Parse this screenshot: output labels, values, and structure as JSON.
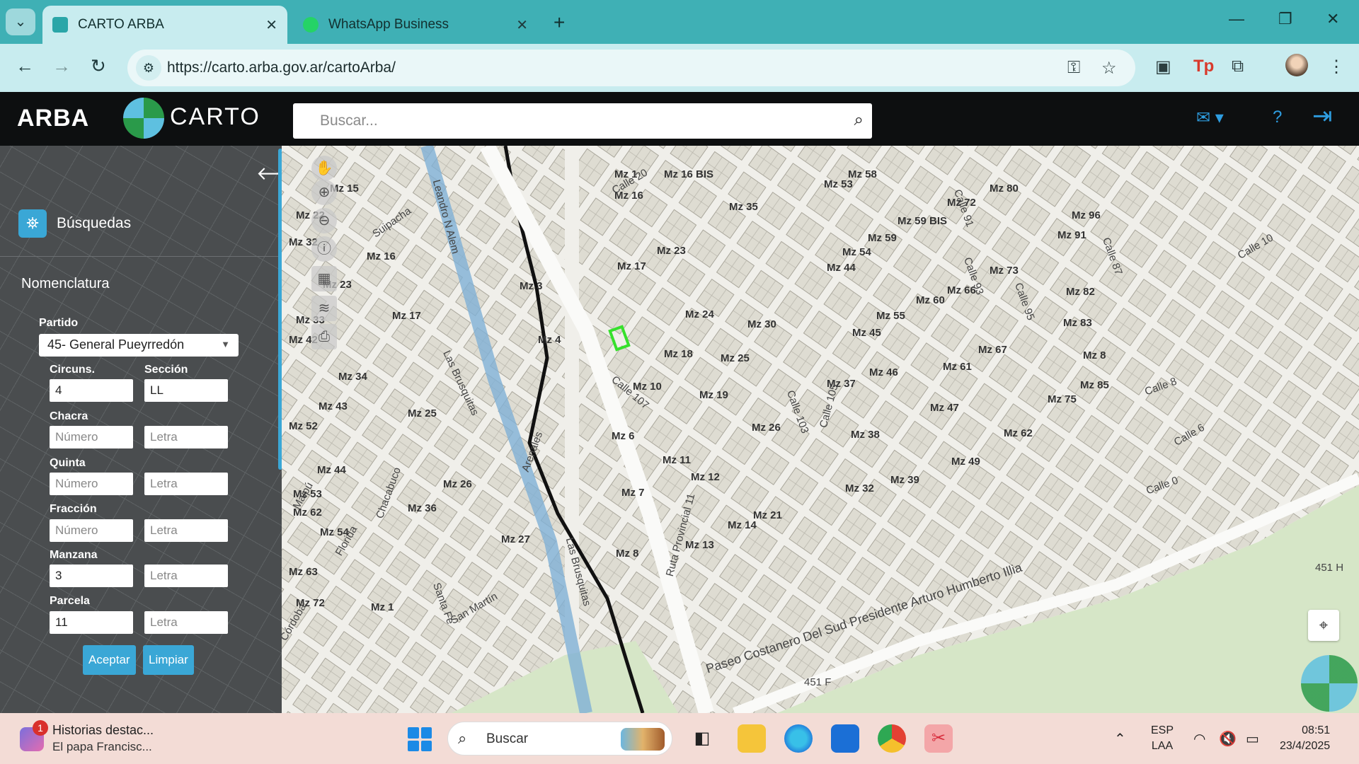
{
  "browser": {
    "tabs": [
      {
        "title": "CARTO ARBA",
        "active": true,
        "favicon": "arba-favicon"
      },
      {
        "title": "WhatsApp Business",
        "active": false,
        "favicon": "whatsapp-favicon"
      }
    ],
    "url": "https://carto.arba.gov.ar/cartoArba/"
  },
  "app": {
    "logo": "ARBA",
    "carto": "CARTO",
    "search_placeholder": "Buscar..."
  },
  "panel": {
    "busquedas": "Búsquedas",
    "section": "Nomenclatura",
    "partido_label": "Partido",
    "partido_value": "45- General Pueyrredón",
    "circuns_label": "Circuns.",
    "circuns_value": "4",
    "seccion_label": "Sección",
    "seccion_value": "LL",
    "chacra_label": "Chacra",
    "quinta_label": "Quinta",
    "fraccion_label": "Fracción",
    "manzana_label": "Manzana",
    "manzana_value": "3",
    "parcela_label": "Parcela",
    "parcela_value": "11",
    "numero_placeholder": "Número",
    "letra_placeholder": "Letra",
    "aceptar": "Aceptar",
    "limpiar": "Limpiar"
  },
  "map": {
    "manzanas": [
      {
        "t": "Mz 1"
      },
      {
        "t": "Mz 16 BIS"
      },
      {
        "t": "Mz 58"
      },
      {
        "t": "Mz 15"
      },
      {
        "t": "Mz 16"
      },
      {
        "t": "Mz 53"
      },
      {
        "t": "Mz 80"
      },
      {
        "t": "Mz 22"
      },
      {
        "t": "Mz 35"
      },
      {
        "t": "Mz 72"
      },
      {
        "t": "Mz 96"
      },
      {
        "t": "Mz 59 BIS"
      },
      {
        "t": "Mz 32"
      },
      {
        "t": "Mz 59"
      },
      {
        "t": "Mz 91"
      },
      {
        "t": "Mz 16"
      },
      {
        "t": "Mz 23"
      },
      {
        "t": "Mz 54"
      },
      {
        "t": "Mz 23"
      },
      {
        "t": "Mz 17"
      },
      {
        "t": "Mz 44"
      },
      {
        "t": "Mz 73"
      },
      {
        "t": "Mz 3"
      },
      {
        "t": "Mz 66"
      },
      {
        "t": "Mz 82"
      },
      {
        "t": "Mz 33"
      },
      {
        "t": "Mz 17"
      },
      {
        "t": "Mz 24"
      },
      {
        "t": "Mz 60"
      },
      {
        "t": "Mz 30"
      },
      {
        "t": "Mz 55"
      },
      {
        "t": "Mz 83"
      },
      {
        "t": "Mz 42"
      },
      {
        "t": "Mz 45"
      },
      {
        "t": "Mz 4"
      },
      {
        "t": "Mz 18"
      },
      {
        "t": "Mz 67"
      },
      {
        "t": "Mz 8"
      },
      {
        "t": "Mz 25"
      },
      {
        "t": "Mz 61"
      },
      {
        "t": "Mz 34"
      },
      {
        "t": "Mz 46"
      },
      {
        "t": "Mz 85"
      },
      {
        "t": "Mz 37"
      },
      {
        "t": "Mz 10"
      },
      {
        "t": "Mz 19"
      },
      {
        "t": "Mz 75"
      },
      {
        "t": "Mz 43"
      },
      {
        "t": "Mz 47"
      },
      {
        "t": "Mz 25"
      },
      {
        "t": "Mz 52"
      },
      {
        "t": "Mz 26"
      },
      {
        "t": "Mz 38"
      },
      {
        "t": "Mz 62"
      },
      {
        "t": "Mz 6"
      },
      {
        "t": "Mz 11"
      },
      {
        "t": "Mz 49"
      },
      {
        "t": "Mz 44"
      },
      {
        "t": "Mz 26"
      },
      {
        "t": "Mz 12"
      },
      {
        "t": "Mz 39"
      },
      {
        "t": "Mz 32"
      },
      {
        "t": "Mz 53"
      },
      {
        "t": "Mz 7"
      },
      {
        "t": "Mz 62"
      },
      {
        "t": "Mz 36"
      },
      {
        "t": "Mz 21"
      },
      {
        "t": "Mz 14"
      },
      {
        "t": "Mz 54"
      },
      {
        "t": "Mz 27"
      },
      {
        "t": "Mz 13"
      },
      {
        "t": "Mz 63"
      },
      {
        "t": "Mz 8"
      },
      {
        "t": "Mz 72"
      },
      {
        "t": "Mz 1"
      }
    ],
    "streets": [
      "Leandro N Alem",
      "Suipacha",
      "Calle 20",
      "Calle 91",
      "Calle 93",
      "Calle 95",
      "Calle 87",
      "Calle 10",
      "Las Brusquitas",
      "Calle 107",
      "Calle 103",
      "Calle 105",
      "Calle 8",
      "Calle 6",
      "Las Brusquitas",
      "Santa Fe",
      "San Martín",
      "Maipú",
      "Florida",
      "Ruta Provincial 11",
      "Paseo Costanero Del Sud Presidente Arturo Humberto Illia",
      "Calle 0",
      "451 F",
      "451 H",
      "Córdoba",
      "Chacabuco",
      "Arenales"
    ]
  },
  "taskbar": {
    "news_badge": "1",
    "news_title": "Historias destac...",
    "news_sub": "El papa Francisc...",
    "search": "Buscar",
    "lang1": "ESP",
    "lang2": "LAA",
    "time": "08:51",
    "date": "23/4/2025"
  }
}
